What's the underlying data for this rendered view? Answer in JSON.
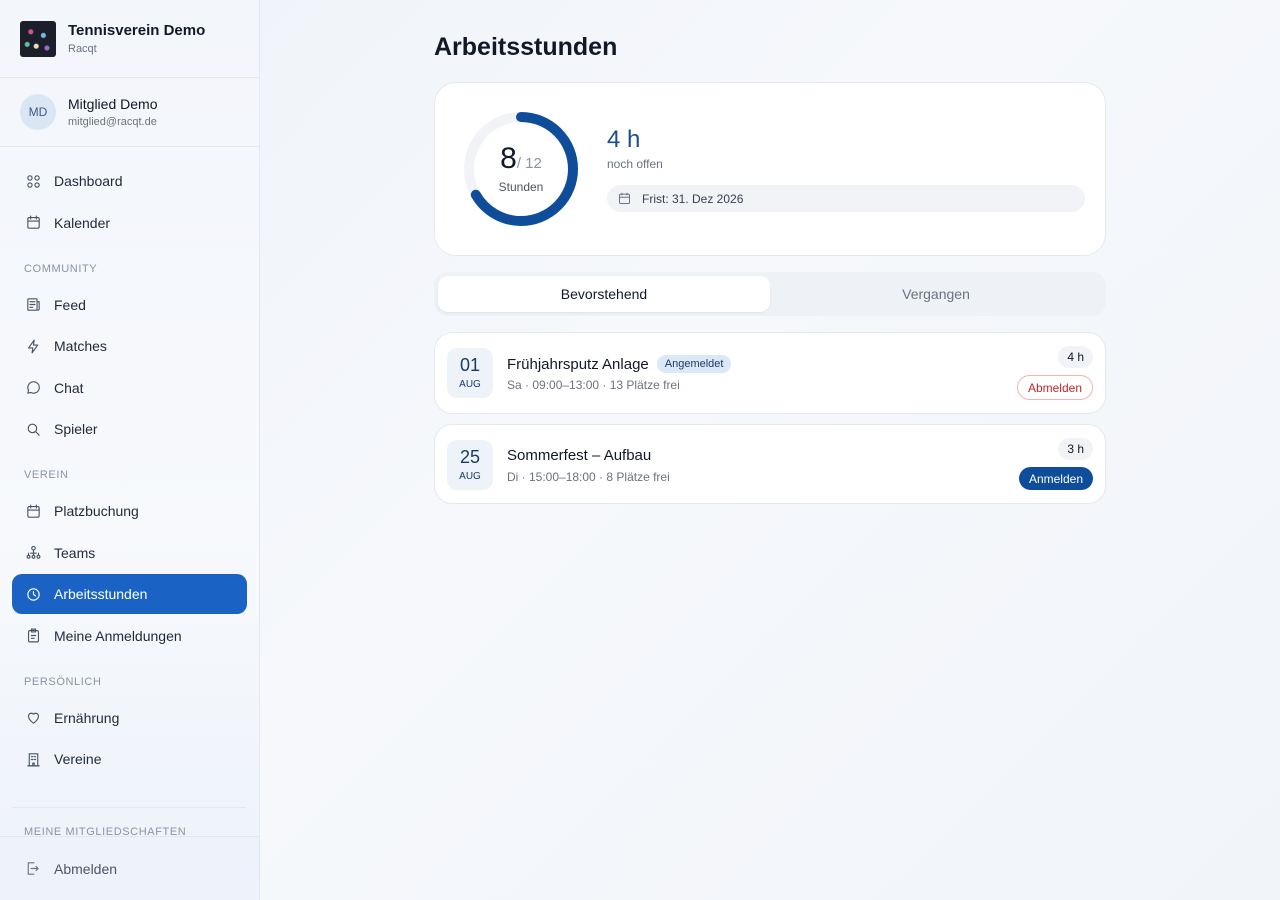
{
  "club": {
    "name": "Tennisverein Demo",
    "sub": "Racqt"
  },
  "user": {
    "initials": "MD",
    "name": "Mitglied Demo",
    "email": "mitglied@racqt.de"
  },
  "nav": {
    "dashboard": "Dashboard",
    "kalender": "Kalender",
    "section_community": "COMMUNITY",
    "feed": "Feed",
    "matches": "Matches",
    "chat": "Chat",
    "spieler": "Spieler",
    "section_verein": "VEREIN",
    "platzbuchung": "Platzbuchung",
    "teams": "Teams",
    "arbeitsstunden": "Arbeitsstunden",
    "anmeldungen": "Meine Anmeldungen",
    "section_persoenlich": "PERSÖNLICH",
    "ernaehrung": "Ernährung",
    "vereine": "Vereine",
    "section_memberships": "MEINE MITGLIEDSCHAFTEN",
    "logout": "Abmelden"
  },
  "page": {
    "title": "Arbeitsstunden"
  },
  "summary": {
    "done": "8",
    "total": "/ 12",
    "unit": "Stunden",
    "progress": 0.667,
    "open_hours": "4 h",
    "open_label": "noch offen",
    "deadline": "Frist: 31. Dez 2026",
    "colors": {
      "ring": "#0f4d9a",
      "track": "#f1f3f6"
    }
  },
  "tabs": {
    "upcoming": "Bevorstehend",
    "past": "Vergangen"
  },
  "events": [
    {
      "day": "01",
      "month": "AUG",
      "title": "Frühjahrsputz Anlage",
      "badge": "Angemeldet",
      "meta": "Sa · 09:00–13:00 · 13 Plätze frei",
      "hours": "4 h",
      "action": "Abmelden"
    },
    {
      "day": "25",
      "month": "AUG",
      "title": "Sommerfest – Aufbau",
      "meta": "Di · 15:00–18:00 · 8 Plätze frei",
      "hours": "3 h",
      "action": "Anmelden"
    }
  ]
}
